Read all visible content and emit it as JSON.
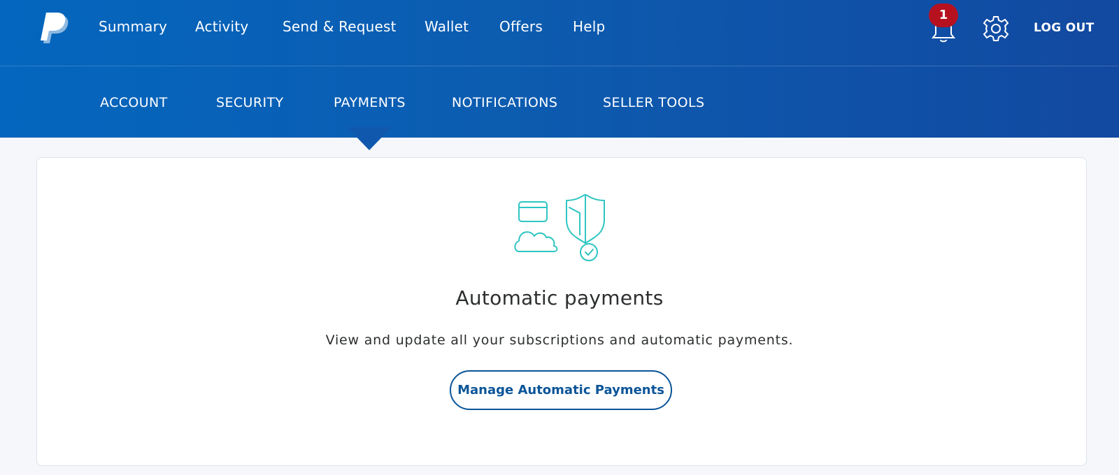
{
  "nav": {
    "items": [
      "Summary",
      "Activity",
      "Send & Request",
      "Wallet",
      "Offers",
      "Help"
    ],
    "notification_count": "1",
    "logout_label": "LOG OUT"
  },
  "settings_tabs": {
    "items": [
      "ACCOUNT",
      "SECURITY",
      "PAYMENTS",
      "NOTIFICATIONS",
      "SELLER TOOLS"
    ],
    "active": "PAYMENTS"
  },
  "card": {
    "icon": "automatic-payments-illustration",
    "title": "Automatic payments",
    "description": "View and update all your subscriptions and automatic payments.",
    "button_label": "Manage Automatic Payments"
  },
  "colors": {
    "header_gradient_start": "#0466be",
    "header_gradient_end": "#1249a1",
    "badge": "#b5111f",
    "button_accent": "#0b5599",
    "illustration": "#2ec5c2"
  }
}
